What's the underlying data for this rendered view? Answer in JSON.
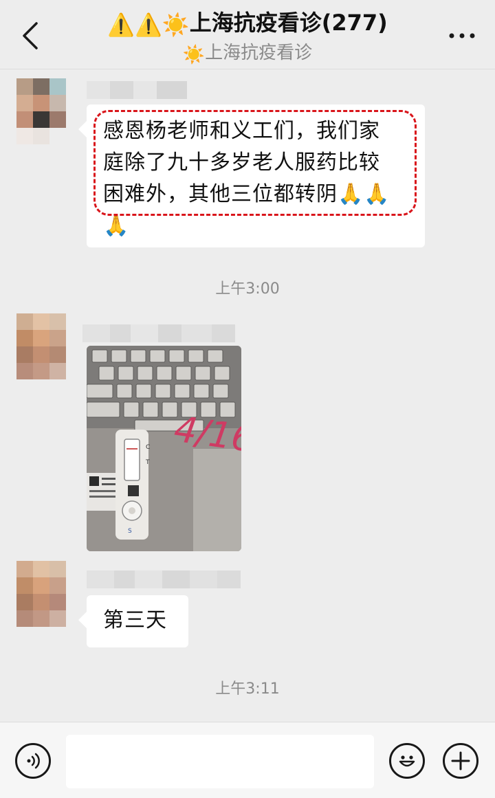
{
  "header": {
    "title_icons": [
      "⚠️",
      "⚠️",
      "☀️"
    ],
    "title_text": "上海抗疫看诊(277)",
    "subtitle_icon": "☀️",
    "subtitle_text": "上海抗疫看诊",
    "back_icon": "chevron-left-icon",
    "more_icon": "more-dots-icon"
  },
  "messages": [
    {
      "type": "text",
      "lines": [
        "感恩杨老师和义工们，我们家",
        "庭除了九十多岁老人服药比较",
        "困难外，其他三位都转阴🙏🙏",
        "🙏"
      ],
      "highlighted": true
    },
    {
      "type": "timestamp",
      "text": "上午3:00"
    },
    {
      "type": "image",
      "description_icon": "antigen-test-photo",
      "handwriting": "4/16",
      "test_letters": [
        "C",
        "T",
        "S"
      ]
    },
    {
      "type": "text",
      "lines": [
        "第三天"
      ]
    },
    {
      "type": "timestamp",
      "text": "上午3:11"
    }
  ],
  "input_bar": {
    "voice_icon": "voice-icon",
    "emoji_icon": "emoji-icon",
    "plus_icon": "plus-icon",
    "input_value": ""
  },
  "colors": {
    "background": "#ededed",
    "bubble": "#ffffff",
    "highlight": "#d9151b",
    "timestamp": "#8a8a8a"
  }
}
